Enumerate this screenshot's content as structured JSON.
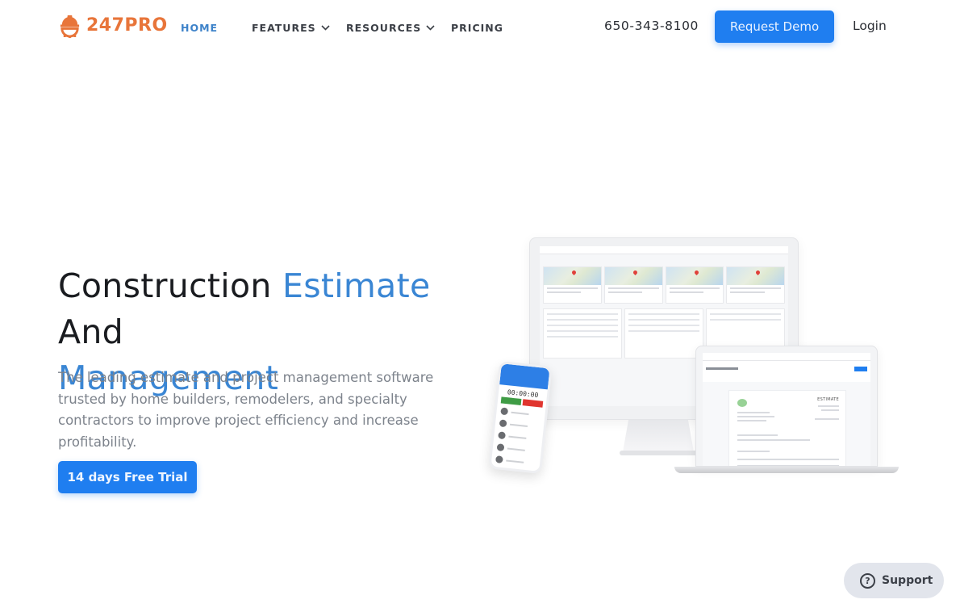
{
  "nav": {
    "brand": "247PRO",
    "links": [
      {
        "label": "HOME",
        "active": true,
        "has_dropdown": false
      },
      {
        "label": "FEATURES",
        "active": false,
        "has_dropdown": true
      },
      {
        "label": "RESOURCES",
        "active": false,
        "has_dropdown": true
      },
      {
        "label": "PRICING",
        "active": false,
        "has_dropdown": false
      }
    ],
    "phone": "650-343-8100",
    "request_demo_label": "Request Demo",
    "login_label": "Login"
  },
  "hero": {
    "headline_part1": "Construction ",
    "headline_accent1": "Estimate",
    "headline_part2": " And ",
    "headline_accent2": "Management",
    "subtext": "The leading estimate and project management software trusted by home builders, remodelers, and specialty contractors to improve project efficiency and increase profitability.",
    "cta_label": "14 days Free Trial"
  },
  "mockup": {
    "phone_timer": "00:00:00",
    "laptop_doc_label": "ESTIMATE"
  },
  "support": {
    "label": "Support",
    "icon": "question-circle-icon"
  },
  "colors": {
    "brand_orange": "#e8753a",
    "accent_blue": "#3a86d4",
    "button_blue": "#1f7ef0",
    "text_dark": "#1a1c20",
    "text_muted": "#7d838c"
  }
}
